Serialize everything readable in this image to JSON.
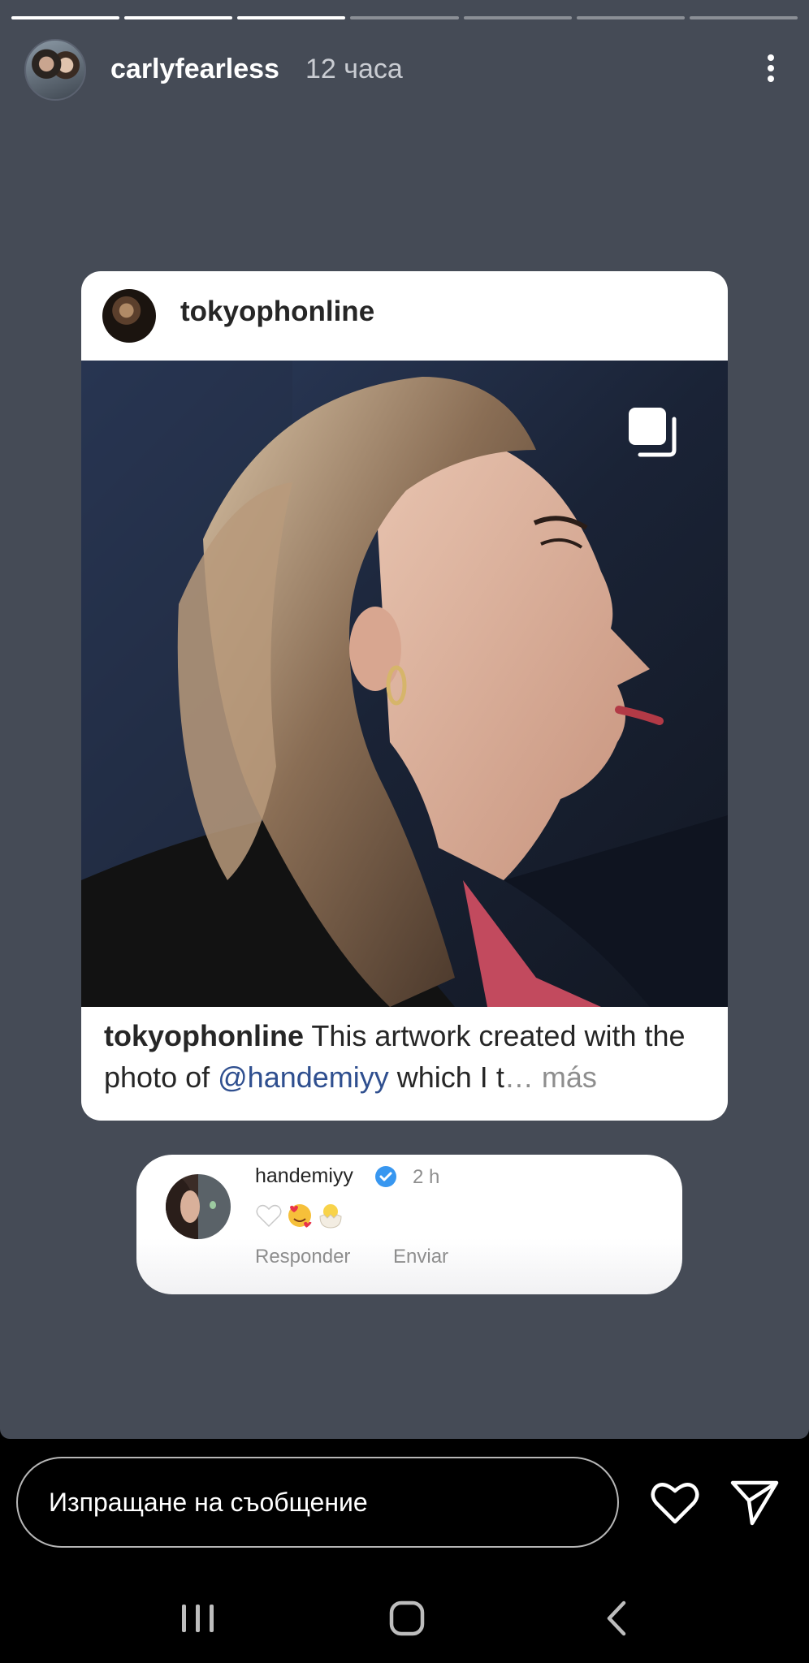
{
  "story": {
    "progress": {
      "total_segments": 7,
      "completed_segments": 3,
      "current_segment": 4
    },
    "author": {
      "username": "carlyfearless",
      "time_ago": "12 часа"
    },
    "colors": {
      "background": "#454b56",
      "mention": "#2f4f8f"
    }
  },
  "post": {
    "username": "tokyophonline",
    "caption": {
      "user": "tokyophonline",
      "text_before": " This artwork created with the photo of ",
      "mention": "@handemiyy",
      "text_after": " which I t",
      "more": "… más"
    }
  },
  "comment": {
    "username": "handemiyy",
    "verified": true,
    "time_ago": "2 h",
    "emojis": [
      "white-heart",
      "smiling-face-with-hearts",
      "hatching-chick"
    ],
    "reply_label": "Responder",
    "send_label": "Enviar"
  },
  "reply_bar": {
    "placeholder": "Изпращане на съобщение"
  },
  "icons": {
    "menu": "more-vertical-icon",
    "like": "heart-icon",
    "share": "send-icon",
    "carousel": "carousel-icon"
  }
}
